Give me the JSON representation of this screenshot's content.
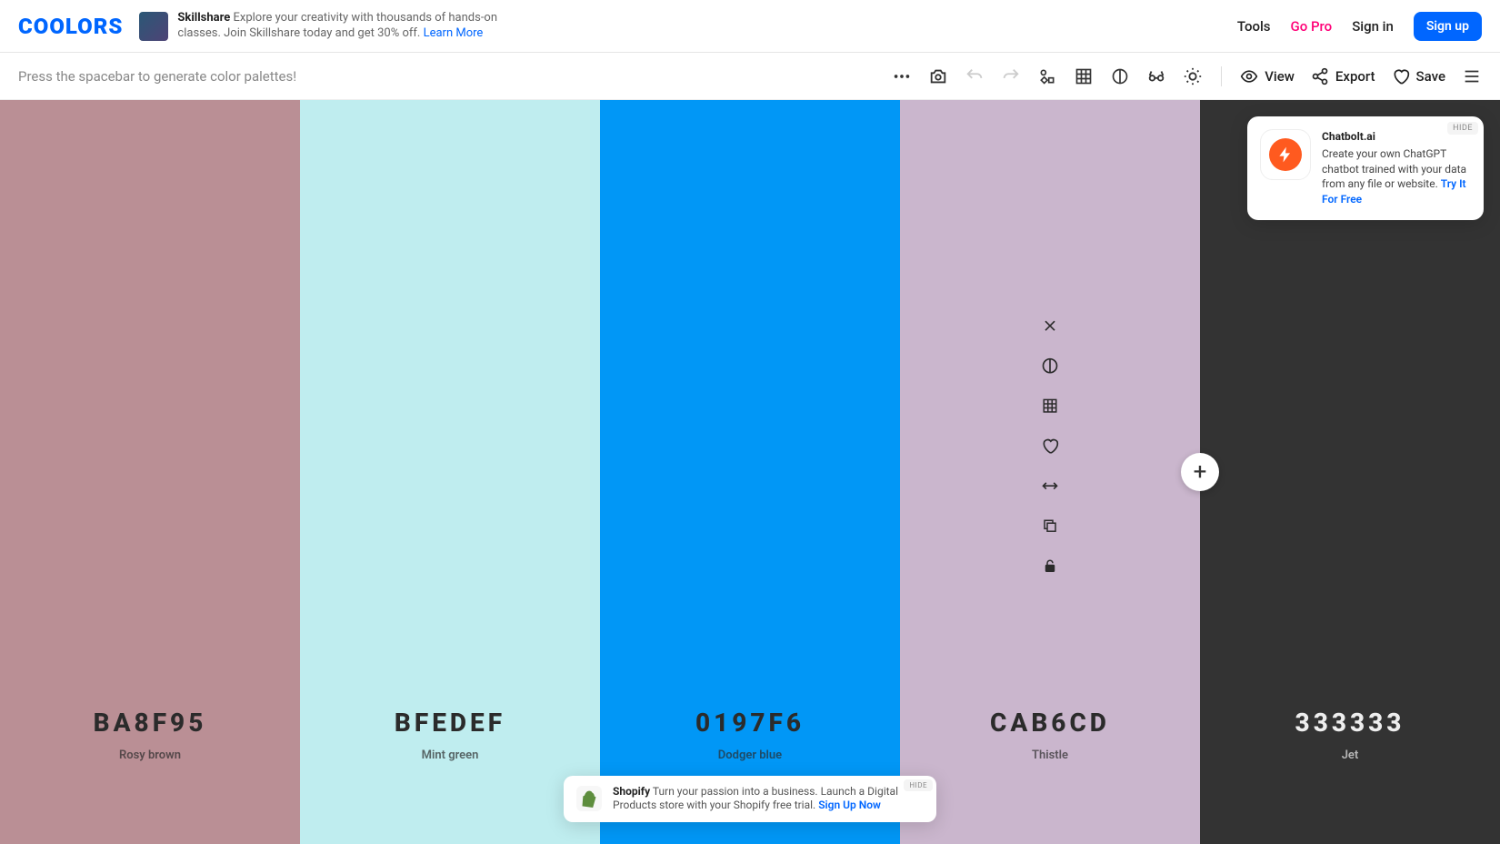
{
  "header": {
    "logo": "COOLORS",
    "ad": {
      "title": "Skillshare",
      "text": "Explore your creativity with thousands of hands-on classes. Join Skillshare today and get 30% off.",
      "cta": "Learn More"
    },
    "tools_label": "Tools",
    "go_pro_label": "Go Pro",
    "sign_in_label": "Sign in",
    "sign_up_label": "Sign up"
  },
  "toolbar": {
    "hint": "Press the spacebar to generate color palettes!",
    "view_label": "View",
    "export_label": "Export",
    "save_label": "Save"
  },
  "palette": {
    "columns": [
      {
        "hex": "BA8F95",
        "name": "Rosy brown",
        "bg": "#BA8F95",
        "text": "dark"
      },
      {
        "hex": "BFEDEF",
        "name": "Mint green",
        "bg": "#BFEDEF",
        "text": "dark"
      },
      {
        "hex": "0197F6",
        "name": "Dodger blue",
        "bg": "#0197F6",
        "text": "dark"
      },
      {
        "hex": "CAB6CD",
        "name": "Thistle",
        "bg": "#CAB6CD",
        "text": "dark"
      },
      {
        "hex": "333333",
        "name": "Jet",
        "bg": "#333333",
        "text": "light"
      }
    ],
    "add_button_after_index": 3
  },
  "side_promo": {
    "hide_label": "HIDE",
    "title": "Chatbolt.ai",
    "text": "Create your own ChatGPT chatbot trained with your data from any file or website.",
    "cta": "Try It For Free"
  },
  "bottom_banner": {
    "hide_label": "HIDE",
    "title": "Shopify",
    "text": "Turn your passion into a business. Launch a Digital Products store with your Shopify free trial.",
    "cta": "Sign Up Now"
  },
  "icons": {
    "plus": "+"
  }
}
